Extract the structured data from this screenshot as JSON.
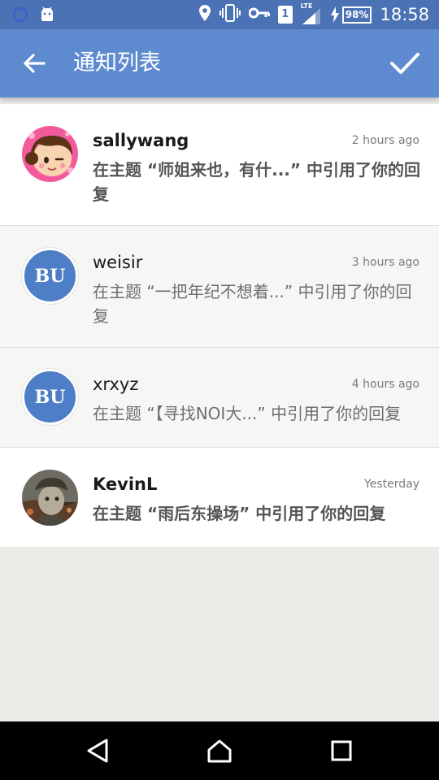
{
  "status_bar": {
    "time": "18:58",
    "battery": "98%",
    "sim": "1",
    "network": "LTE",
    "icons": [
      "sync-icon",
      "android-icon",
      "location-icon",
      "vibrate-icon",
      "key-icon",
      "sim-icon",
      "signal-icon",
      "charging-icon",
      "battery-icon"
    ]
  },
  "toolbar": {
    "title": "通知列表",
    "back_icon": "arrow-left-icon",
    "confirm_icon": "check-icon",
    "color": "#5e8bd0"
  },
  "notifications": [
    {
      "username": "sallywang",
      "time": "2 hours ago",
      "summary": "在主题 “师姐来也，有什...” 中引用了你的回复",
      "read": false,
      "avatar": "photo"
    },
    {
      "username": "weisir",
      "time": "3 hours ago",
      "summary": "在主题 “一把年纪不想着...” 中引用了你的回复",
      "read": true,
      "avatar": "BU"
    },
    {
      "username": "xrxyz",
      "time": "4 hours ago",
      "summary": "在主题 “【寻找NOI大...” 中引用了你的回复",
      "read": true,
      "avatar": "BU"
    },
    {
      "username": "KevinL",
      "time": "Yesterday",
      "summary": "在主题 “雨后东操场” 中引用了你的回复",
      "read": false,
      "avatar": "photo"
    }
  ],
  "navbar": {
    "icons": [
      "back-triangle-icon",
      "home-icon",
      "recents-icon"
    ]
  }
}
